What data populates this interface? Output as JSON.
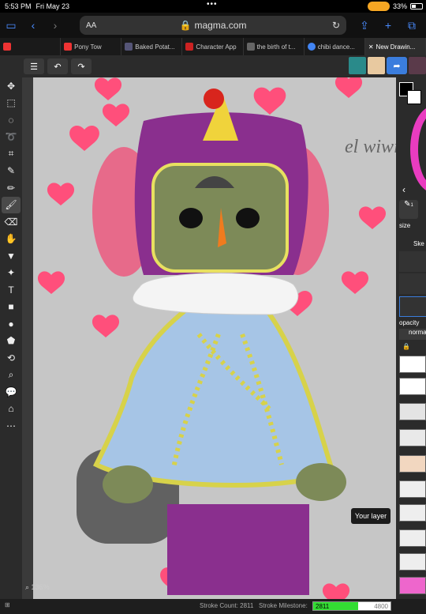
{
  "status": {
    "time": "5:53 PM",
    "date": "Fri May 23",
    "battery": "33%"
  },
  "browser": {
    "url": "magma.com",
    "aa_label": "AA",
    "tabs": [
      {
        "label": "",
        "fav": "#e33"
      },
      {
        "label": "Pony Tow",
        "fav": "#e33"
      },
      {
        "label": "Baked Potat...",
        "fav": "#557"
      },
      {
        "label": "Character App",
        "fav": "#c22"
      },
      {
        "label": "the birth of t...",
        "fav": "#666"
      },
      {
        "label": "chibi dance...",
        "fav": "#4285f4"
      },
      {
        "label": "New Drawin...",
        "fav": "#888"
      }
    ]
  },
  "canvas": {
    "zoom": "136%",
    "handwriting": "el wiwi",
    "tooltip": "Your layer"
  },
  "panel": {
    "size_label": "size",
    "opacity_label": "opacity",
    "blend_label": "norma",
    "brush_section": "Ske",
    "size_value": "1"
  },
  "footer": {
    "stroke_count": "Stroke Count: 2811",
    "stroke_milestone": "Stroke Milestone:",
    "progress_value": "2811",
    "progress_max": "4800",
    "progress_fraction": 0.586
  },
  "colors": {
    "accent": "#3b7ddd",
    "heart": "#ff4f7b",
    "paper": "#c6c6c6"
  }
}
